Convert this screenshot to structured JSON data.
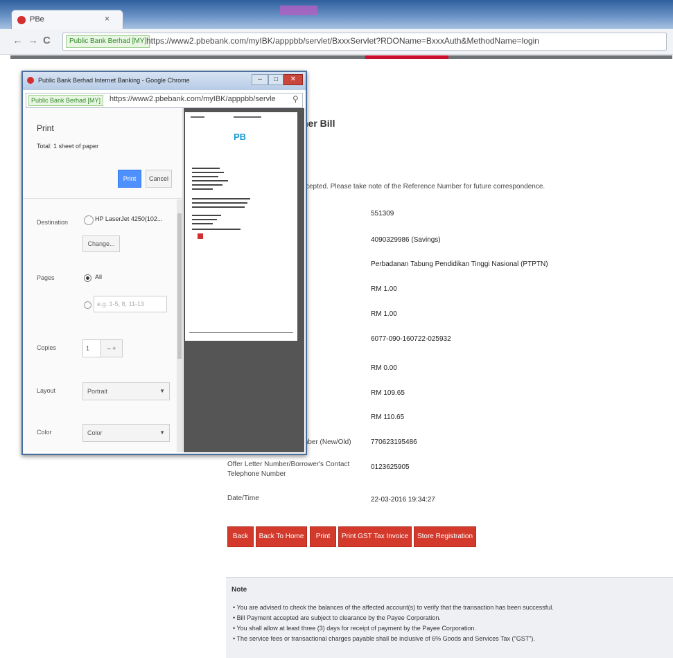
{
  "browser": {
    "tab_title": "PBe",
    "tab_close": "×",
    "nav": {
      "back": "←",
      "forward": "→",
      "reload": "C"
    },
    "ev_badge": "Public Bank Berhad [MY]",
    "url": "https://www2.pbebank.com/myIBK/apppbb/servlet/BxxxServlet?RDOName=BxxxAuth&MethodName=login"
  },
  "page": {
    "heading": "her Bill",
    "success_message": "ccepted. Please take note of the Reference Number for future correspondence.",
    "values": [
      "551309",
      "4090329986  (Savings)",
      "Perbadanan Tabung Pendidikan Tinggi Nasional (PTPTN)",
      "RM 1.00",
      "RM 1.00",
      "6077-090-160722-025932",
      "RM 0.00",
      "RM 109.65",
      "RM 110.65",
      "770623195486",
      "0123625905",
      "22-03-2016 19:34:27"
    ],
    "labels": {
      "id_number": "mber (New/Old)",
      "offer_letter": "Offer Letter Number/Borrower's Contact Telephone Number",
      "datetime": "Date/Time"
    },
    "buttons": [
      "Back",
      "Back To Home",
      "Print",
      "Print GST Tax Invoice",
      "Store Registration"
    ],
    "note": {
      "title": "Note",
      "items": [
        "You are advised to check the balances of the affected account(s) to verify that the transaction has been successful.",
        "Bill Payment accepted are subject to clearance by the Payee Corporation.",
        "You shall allow at least three (3) days for receipt of payment by the Payee Corporation.",
        "The service fees or transactional charges payable shall be inclusive of 6% Goods and Services Tax (\"GST\")."
      ]
    }
  },
  "popup": {
    "title": "Public Bank Berhad Internet Banking - Google Chrome",
    "ev_badge": "Public Bank Berhad [MY]",
    "url": "https://www2.pbebank.com/myIBK/apppbb/servle",
    "print": {
      "title": "Print",
      "total": "Total: 1 sheet of paper",
      "print_button": "Print",
      "cancel_button": "Cancel",
      "destination_label": "Destination",
      "destination_value": "HP LaserJet 4250(102...",
      "change_button": "Change...",
      "pages_label": "Pages",
      "pages_all": "All",
      "pages_placeholder": "e.g. 1-5, 8, 11-13",
      "copies_label": "Copies",
      "copies_value": "1",
      "copies_stepper": "–  +",
      "layout_label": "Layout",
      "layout_value": "Portrait",
      "color_label": "Color",
      "color_value": "Color"
    },
    "preview_logo": "PB"
  }
}
